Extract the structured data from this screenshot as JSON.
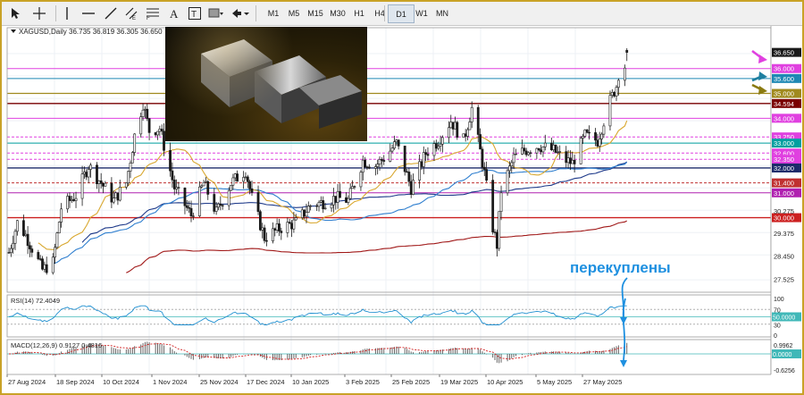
{
  "toolbar": {
    "timeframes": [
      "M1",
      "M5",
      "M15",
      "M30",
      "H1",
      "H4",
      "D1",
      "W1",
      "MN"
    ],
    "active_timeframe": "D1"
  },
  "chart": {
    "header": "XAGUSD,Daily  36.735 36.819 36.305 36.650",
    "annotation": "перекуплены",
    "price_axis": [
      "36.650",
      "36.000",
      "35.600",
      "35.000",
      "34.594",
      "34.000",
      "33.250",
      "33.000",
      "32.600",
      "32.350",
      "32.000",
      "31.400",
      "31.000",
      "30.000",
      "30.275",
      "29.375",
      "28.450",
      "27.525"
    ],
    "time_axis": [
      "27 Aug 2024",
      "18 Sep 2024",
      "10 Oct 2024",
      "1 Nov 2024",
      "25 Nov 2024",
      "17 Dec 2024",
      "10 Jan 2025",
      "3 Feb 2025",
      "25 Feb 2025",
      "19 Mar 2025",
      "10 Apr 2025",
      "5 May 2025",
      "27 May 2025"
    ],
    "rsi": {
      "header": "RSI(14) 72.4049",
      "scale": [
        "100",
        "70",
        "30",
        "0"
      ],
      "level_label": "50.0000"
    },
    "macd": {
      "header": "MACD(12,26,9) 0.9127 0.4816",
      "scale": [
        "0.9962",
        "-0.6256"
      ],
      "level_label": "0.0000"
    }
  },
  "levels": [
    {
      "price": 36.0,
      "color": "#e040e0",
      "label": "36.000"
    },
    {
      "price": 35.6,
      "color": "#1e88b4",
      "label": "35.600"
    },
    {
      "price": 35.0,
      "color": "#a08a1e",
      "label": "35.000"
    },
    {
      "price": 34.594,
      "color": "#7a0000",
      "label": "34.594"
    },
    {
      "price": 34.0,
      "color": "#e040e0",
      "label": "34.000"
    },
    {
      "price": 33.25,
      "color": "#e040e0",
      "label": "33.250"
    },
    {
      "price": 33.0,
      "color": "#00a0a0",
      "label": "33.000"
    },
    {
      "price": 32.6,
      "color": "#e040e0",
      "label": "32.600"
    },
    {
      "price": 32.35,
      "color": "#e040e0",
      "label": "32.350"
    },
    {
      "price": 32.0,
      "color": "#1c2a6a",
      "label": "32.000"
    },
    {
      "price": 31.4,
      "color": "#c03030",
      "label": "31.400"
    },
    {
      "price": 31.0,
      "color": "#b020b0",
      "label": "31.000"
    },
    {
      "price": 30.0,
      "color": "#cc2020",
      "label": "30.000"
    }
  ],
  "colors": {
    "up_candle": "#1a1a1a",
    "ma_fast": "#d9a830",
    "ma_mid": "#1e3a8a",
    "ma_slow": "#a01818",
    "ma_extra": "#2f7fcf",
    "rsi_line": "#1f8fd0",
    "annotation": "#1e90e0",
    "arrow_magenta": "#e040e0",
    "arrow_teal": "#1e7fa0",
    "arrow_olive": "#8a7a10"
  }
}
